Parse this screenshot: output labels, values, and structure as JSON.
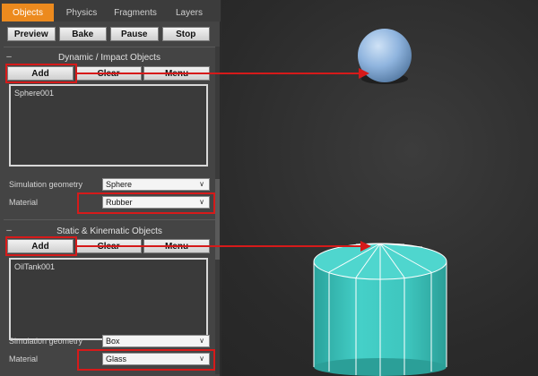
{
  "tabs": [
    "Objects",
    "Physics",
    "Fragments",
    "Layers"
  ],
  "toolbar": {
    "preview": "Preview",
    "bake": "Bake",
    "pause": "Pause",
    "stop": "Stop"
  },
  "dynamic": {
    "title": "Dynamic / Impact Objects",
    "add": "Add",
    "clear": "Clear",
    "menu": "Menu",
    "items": [
      "Sphere001"
    ],
    "geometry_label": "Simulation geometry",
    "geometry_value": "Sphere",
    "material_label": "Material",
    "material_value": "Rubber"
  },
  "static": {
    "title": "Static & Kinematic Objects",
    "add": "Add",
    "clear": "Clear",
    "menu": "Menu",
    "items": [
      "OilTank001"
    ],
    "geometry_label": "Simulation geometry",
    "geometry_value": "Box",
    "material_label": "Material",
    "material_value": "Glass"
  },
  "colors": {
    "accent": "#ec8a1e",
    "highlight": "#d61a1a",
    "sphere": "#8fb4de",
    "cylinder": "#3ec6be"
  },
  "icons": {
    "collapse": "minus-icon",
    "dropdown": "chevron-down-icon"
  }
}
